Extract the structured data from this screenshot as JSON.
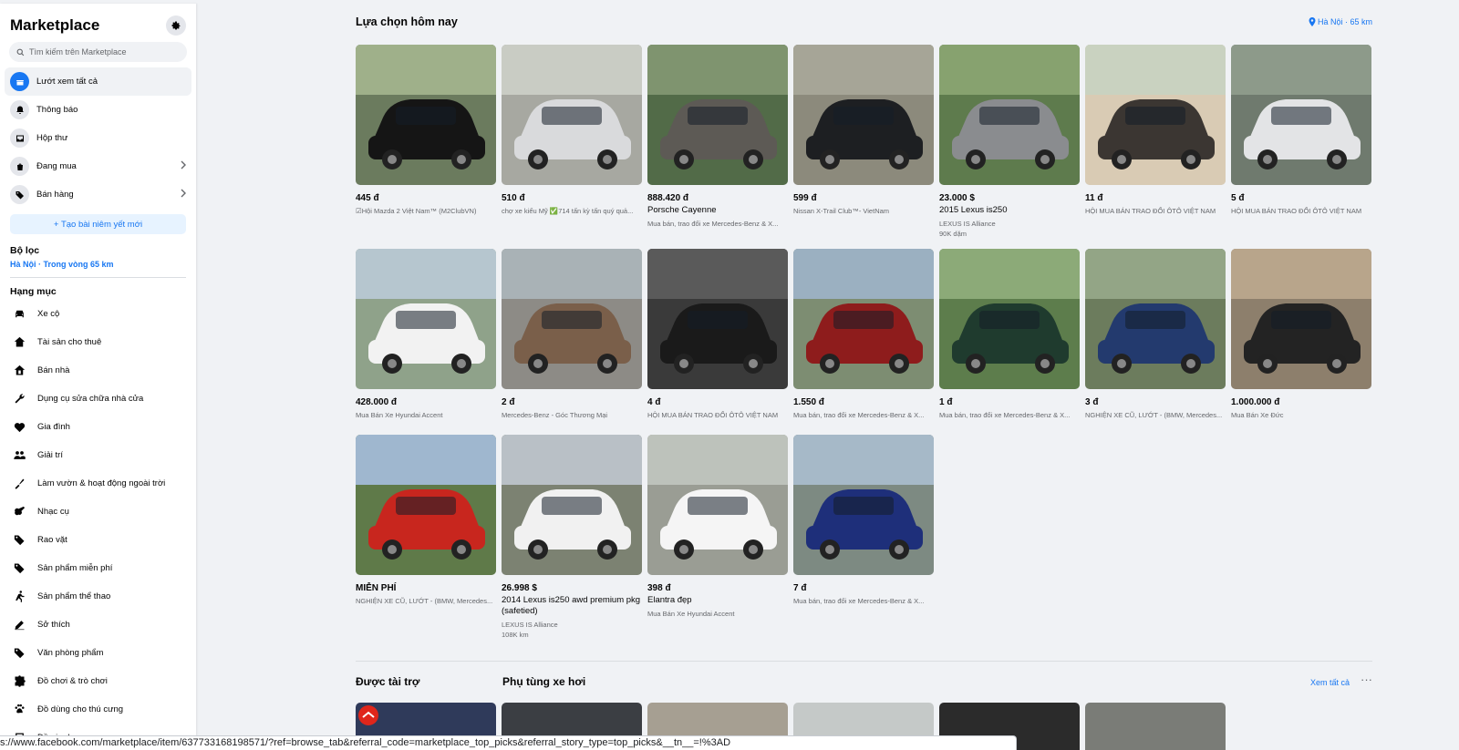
{
  "sidebar": {
    "title": "Marketplace",
    "search_placeholder": "Tìm kiếm trên Marketplace",
    "nav": [
      {
        "label": "Lướt xem tất cả",
        "icon": "store-icon",
        "active": true
      },
      {
        "label": "Thông báo",
        "icon": "bell-icon"
      },
      {
        "label": "Hộp thư",
        "icon": "inbox-icon"
      },
      {
        "label": "Đang mua",
        "icon": "bag-icon",
        "chevron": true
      },
      {
        "label": "Bán hàng",
        "icon": "tag-icon",
        "chevron": true
      }
    ],
    "create_listing": "+ Tạo bài niêm yết mới",
    "filter_title": "Bộ lọc",
    "filter_location": "Hà Nội · Trong vòng 65 km",
    "categories_title": "Hạng mục",
    "categories": [
      {
        "label": "Xe cộ",
        "icon": "car-icon"
      },
      {
        "label": "Tài sản cho thuê",
        "icon": "house-icon"
      },
      {
        "label": "Bán nhà",
        "icon": "house-sale-icon"
      },
      {
        "label": "Dụng cụ sửa chữa nhà cửa",
        "icon": "wrench-icon"
      },
      {
        "label": "Gia đình",
        "icon": "heart-icon"
      },
      {
        "label": "Giải trí",
        "icon": "people-icon"
      },
      {
        "label": "Làm vườn & hoạt động ngoài trời",
        "icon": "garden-icon"
      },
      {
        "label": "Nhạc cụ",
        "icon": "guitar-icon"
      },
      {
        "label": "Rao vặt",
        "icon": "tag-icon"
      },
      {
        "label": "Sản phẩm miễn phí",
        "icon": "free-tag-icon"
      },
      {
        "label": "Sản phẩm thể thao",
        "icon": "running-icon"
      },
      {
        "label": "Sở thích",
        "icon": "pen-icon"
      },
      {
        "label": "Văn phòng phẩm",
        "icon": "tag-icon"
      },
      {
        "label": "Đồ chơi & trò chơi",
        "icon": "puzzle-icon"
      },
      {
        "label": "Đồ dùng cho thú cưng",
        "icon": "paw-icon"
      },
      {
        "label": "Đồ gia dụng",
        "icon": "household-icon"
      }
    ]
  },
  "main": {
    "title": "Lựa chọn hôm nay",
    "location": "Hà Nội · 65 km",
    "listings": [
      {
        "price": "445 đ",
        "title": "",
        "meta": "☑Hội Mazda 2 Việt Nam™ (M2ClubVN)",
        "meta2": "",
        "img": {
          "bg": "#6b7b5e",
          "car": "#151515",
          "sky": "#9fb08a"
        }
      },
      {
        "price": "510 đ",
        "title": "",
        "meta": "chợ xe kiểu Mỹ ✅714 tấn kỳ tấn quý quả...",
        "meta2": "",
        "img": {
          "bg": "#a7a8a1",
          "car": "#d9dadc",
          "sky": "#c9ccc4"
        }
      },
      {
        "price": "888.420 đ",
        "title": "Porsche Cayenne",
        "meta": "Mua bán, trao đổi xe Mercedes-Benz & X...",
        "meta2": "",
        "img": {
          "bg": "#526b48",
          "car": "#5d5a55",
          "sky": "#7f946f"
        }
      },
      {
        "price": "599 đ",
        "title": "",
        "meta": "Nissan X-Trail Club™- VietNam",
        "meta2": "",
        "img": {
          "bg": "#8c8a7c",
          "car": "#1d1f22",
          "sky": "#a6a597"
        }
      },
      {
        "price": "23.000 $",
        "title": "2015 Lexus is250",
        "meta": "LEXUS IS Alliance",
        "meta2": "90K dặm",
        "img": {
          "bg": "#5e7b4d",
          "car": "#8a8c8f",
          "sky": "#87a26f"
        }
      },
      {
        "price": "11 đ",
        "title": "",
        "meta": "HỘI MUA BÁN TRAO ĐỔI ÔTÔ VIỆT NAM",
        "meta2": "",
        "img": {
          "bg": "#d9cbb4",
          "car": "#3b3632",
          "sky": "#c9d2c0"
        }
      },
      {
        "price": "5 đ",
        "title": "",
        "meta": "HỘI MUA BÁN TRAO ĐỔI ÔTÔ VIỆT NAM",
        "meta2": "",
        "img": {
          "bg": "#6f7a6e",
          "car": "#e3e4e6",
          "sky": "#8d9a8a"
        }
      },
      {
        "price": "428.000 đ",
        "title": "",
        "meta": "Mua Bán Xe Hyundai Accent",
        "meta2": "",
        "img": {
          "bg": "#8fa28a",
          "car": "#f2f2f2",
          "sky": "#b6c6cf"
        }
      },
      {
        "price": "2 đ",
        "title": "",
        "meta": "Mercedes-Benz - Góc Thương Mại",
        "meta2": "",
        "img": {
          "bg": "#8d8b86",
          "car": "#7a5f4a",
          "sky": "#a9b2b6"
        }
      },
      {
        "price": "4 đ",
        "title": "",
        "meta": "HỘI MUA BÁN TRAO ĐỔI ÔTÔ VIỆT NAM",
        "meta2": "",
        "img": {
          "bg": "#3a3a3a",
          "car": "#1a1a1a",
          "sky": "#5a5a5a"
        }
      },
      {
        "price": "1.550 đ",
        "title": "",
        "meta": "Mua bán, trao đổi xe Mercedes-Benz & X...",
        "meta2": "",
        "img": {
          "bg": "#7d8d72",
          "car": "#8e1c1c",
          "sky": "#9bb0c1"
        }
      },
      {
        "price": "1 đ",
        "title": "",
        "meta": "Mua bán, trao đổi xe Mercedes-Benz & X...",
        "meta2": "",
        "img": {
          "bg": "#5d7d4c",
          "car": "#1f3b2e",
          "sky": "#8caa78"
        }
      },
      {
        "price": "3 đ",
        "title": "",
        "meta": "NGHIỆN XE CŨ, LƯỚT - (BMW, Mercedes...",
        "meta2": "",
        "img": {
          "bg": "#6c7c5d",
          "car": "#233a6e",
          "sky": "#93a586"
        }
      },
      {
        "price": "1.000.000 đ",
        "title": "",
        "meta": "Mua Bán Xe Đức",
        "meta2": "",
        "img": {
          "bg": "#8d7f6c",
          "car": "#232323",
          "sky": "#b8a58b"
        }
      },
      {
        "price": "MIỄN PHÍ",
        "title": "",
        "meta": "NGHIỆN XE CŨ, LƯỚT - (BMW, Mercedes...",
        "meta2": "",
        "img": {
          "bg": "#5f7a49",
          "car": "#c8261e",
          "sky": "#9fb7cf"
        }
      },
      {
        "price": "26.998 $",
        "title": "2014 Lexus is250 awd premium pkg (safetied)",
        "meta": "LEXUS IS Alliance",
        "meta2": "108K km",
        "img": {
          "bg": "#7c8272",
          "car": "#f1f1f1",
          "sky": "#b9c0c6"
        }
      },
      {
        "price": "398 đ",
        "title": "Elantra đẹp",
        "meta": "Mua Bán Xe Hyundai Accent",
        "meta2": "",
        "img": {
          "bg": "#9a9d94",
          "car": "#f5f5f5",
          "sky": "#bdc2bb"
        }
      },
      {
        "price": "7 đ",
        "title": "",
        "meta": "Mua bán, trao đổi xe Mercedes-Benz & X...",
        "meta2": "",
        "img": {
          "bg": "#7d8a82",
          "car": "#1e2f7a",
          "sky": "#a6b9c8"
        }
      }
    ],
    "sponsored_title": "Được tài trợ",
    "parts_title": "Phụ tùng xe hơi",
    "see_all": "Xem tất cả",
    "more": "···",
    "thumbs": [
      "#2f3a5a",
      "#3b3e43",
      "#a69f92",
      "#c5c9c8",
      "#2b2b2b",
      "#7a7c77"
    ]
  },
  "statusbar": {
    "url": "s://www.facebook.com/marketplace/item/637733168198571/?ref=browse_tab&referral_code=marketplace_top_picks&referral_story_type=top_picks&__tn__=!%3AD"
  },
  "colors": {
    "accent": "#1877f2",
    "bg": "#f0f2f5"
  }
}
